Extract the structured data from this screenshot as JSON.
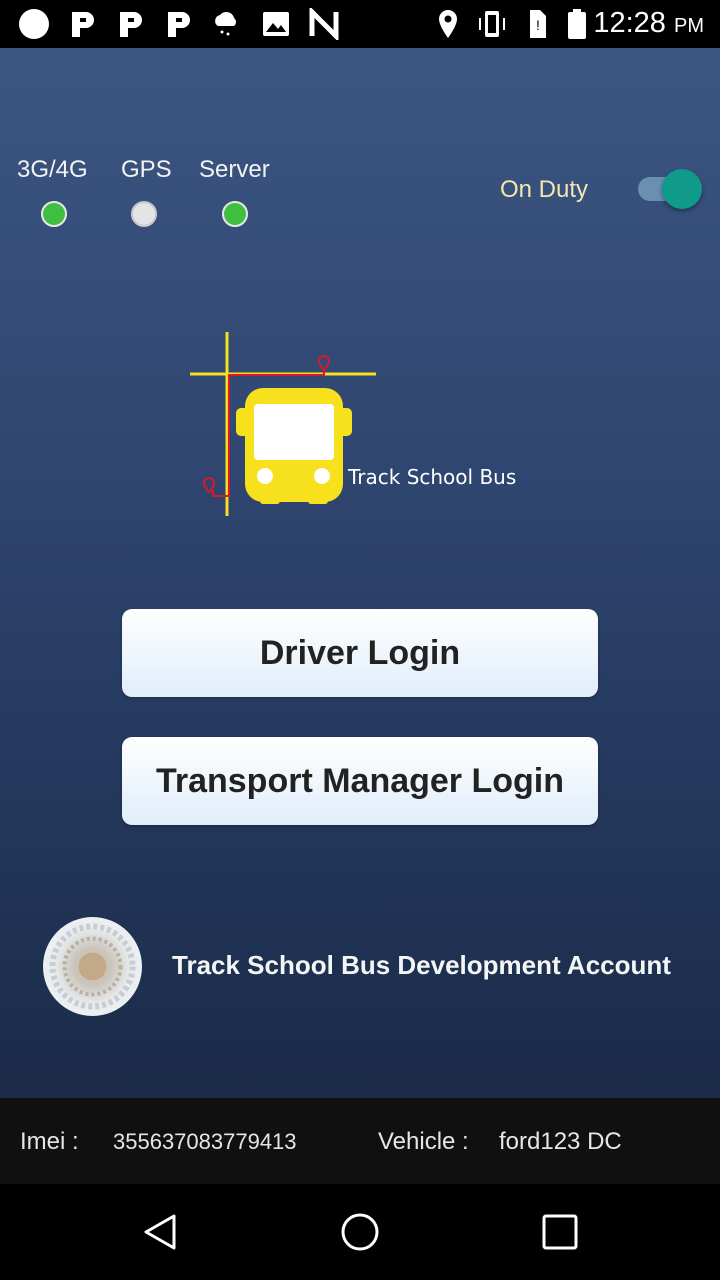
{
  "status_bar": {
    "time": "12:28",
    "ampm": "PM",
    "icons": [
      "circle-icon",
      "p-icon",
      "p-icon",
      "p-icon",
      "cloud-icon",
      "image-icon",
      "signal-icon",
      "location-icon",
      "sim-icon",
      "battery-icon"
    ]
  },
  "indicators": [
    {
      "label": "3G/4G",
      "status": "green"
    },
    {
      "label": "GPS",
      "status": "grey"
    },
    {
      "label": "Server",
      "status": "green"
    }
  ],
  "duty": {
    "label": "On Duty",
    "on": true
  },
  "logo": {
    "text": "Track School Bus"
  },
  "buttons": {
    "driver_login": "Driver Login",
    "manager_login": "Transport Manager Login"
  },
  "account": {
    "name": "Track School Bus Development Account"
  },
  "info": {
    "imei_label": "Imei :",
    "imei_value": "355637083779413",
    "vehicle_label": "Vehicle :",
    "vehicle_value": "ford123 DC"
  },
  "colors": {
    "accent_teal": "#0f9a8a",
    "status_green": "#3fbf3f",
    "logo_yellow": "#f7e01c"
  }
}
